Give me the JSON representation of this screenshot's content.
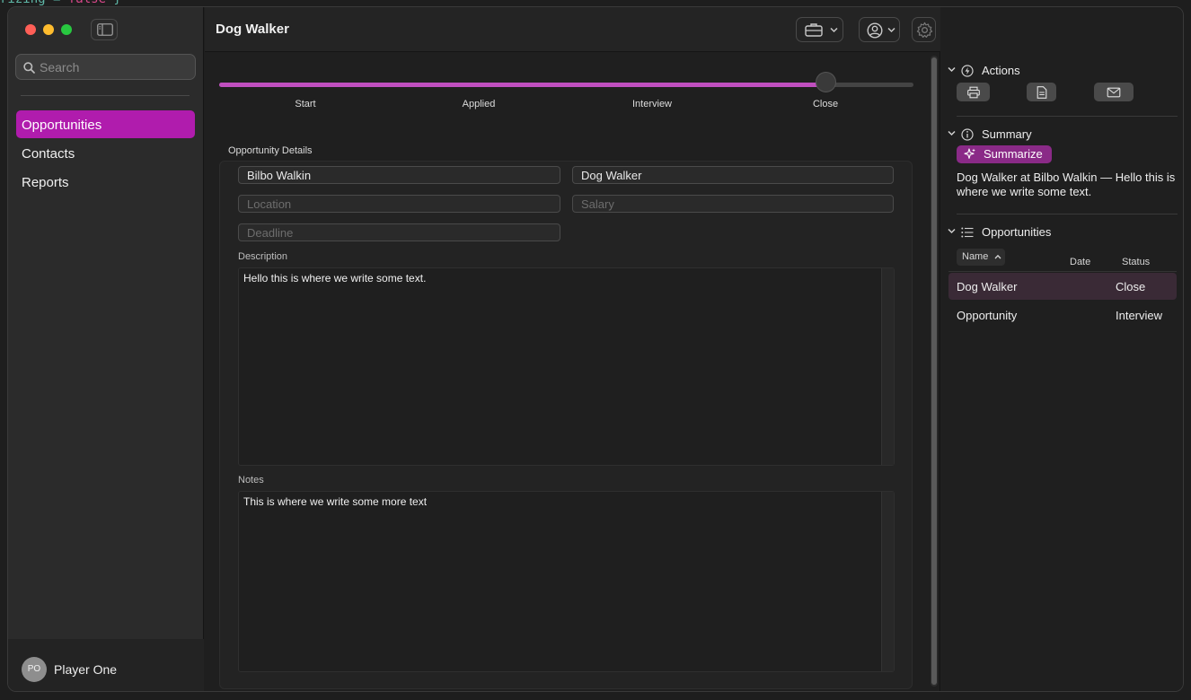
{
  "app": {
    "window_title": "Dog Walker"
  },
  "sidebar": {
    "search_placeholder": "Search",
    "items": [
      {
        "label": "Opportunities",
        "active": true
      },
      {
        "label": "Contacts",
        "active": false
      },
      {
        "label": "Reports",
        "active": false
      }
    ],
    "profile": {
      "initials": "PO",
      "name": "Player One"
    }
  },
  "toolbar": {
    "icons": [
      "briefcase-icon",
      "person-circle-icon",
      "gear-icon"
    ]
  },
  "progress": {
    "steps": [
      "Start",
      "Applied",
      "Interview",
      "Close"
    ],
    "current_step": "Close",
    "value_fraction": 0.875
  },
  "details": {
    "section_title": "Opportunity Details",
    "company": "Bilbo Walkin",
    "role": "Dog Walker",
    "location_placeholder": "Location",
    "salary_placeholder": "Salary",
    "deadline_placeholder": "Deadline",
    "description_label": "Description",
    "description": "Hello this is where we write some text.",
    "notes_label": "Notes",
    "notes": "This is where we write some more text"
  },
  "inspector": {
    "actions_title": "Actions",
    "action_icons": [
      "print-icon",
      "document-icon",
      "envelope-icon"
    ],
    "summary_title": "Summary",
    "summarize_label": "Summarize",
    "summary_text": "Dog Walker at Bilbo Walkin — Hello this is where we write some text.",
    "opportunities_title": "Opportunities",
    "columns": [
      "Name",
      "Date",
      "Status"
    ],
    "rows": [
      {
        "name": "Dog Walker",
        "date": "",
        "status": "Close"
      },
      {
        "name": "Opportunity",
        "date": "",
        "status": "Interview"
      }
    ]
  },
  "colors": {
    "accent": "#b01cad",
    "progress_fill": "#c04fbf",
    "summarize_button": "#8a2a87"
  }
}
